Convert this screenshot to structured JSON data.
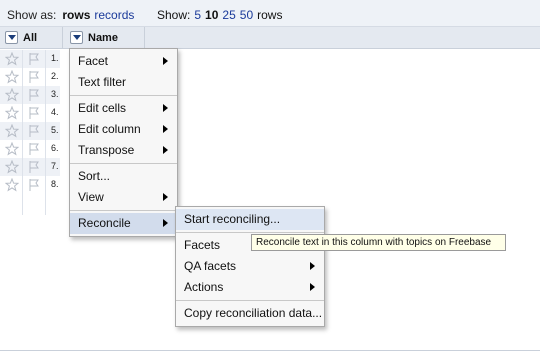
{
  "toolbar": {
    "show_as_label": "Show as:",
    "view_rows": "rows",
    "view_records": "records",
    "show_label": "Show:",
    "page_sizes": [
      "5",
      "10",
      "25",
      "50"
    ],
    "selected_page_size": "10",
    "rows_suffix": "rows"
  },
  "header": {
    "all_label": "All",
    "name_label": "Name"
  },
  "rows": [
    "1.",
    "2.",
    "3.",
    "4.",
    "5.",
    "6.",
    "7.",
    "8."
  ],
  "column_menu": {
    "items": [
      {
        "label": "Facet",
        "submenu": true
      },
      {
        "label": "Text filter",
        "submenu": false
      },
      {
        "label": "Edit cells",
        "submenu": true
      },
      {
        "label": "Edit column",
        "submenu": true
      },
      {
        "label": "Transpose",
        "submenu": true
      },
      {
        "label": "Sort...",
        "submenu": false
      },
      {
        "label": "View",
        "submenu": true
      },
      {
        "label": "Reconcile",
        "submenu": true
      }
    ]
  },
  "reconcile_menu": {
    "items": [
      {
        "label": "Start reconciling...",
        "submenu": false
      },
      {
        "label": "Facets",
        "submenu": false
      },
      {
        "label": "QA facets",
        "submenu": true
      },
      {
        "label": "Actions",
        "submenu": true
      },
      {
        "label": "Copy reconciliation data...",
        "submenu": false
      }
    ]
  },
  "tooltip": "Reconcile text in this column with topics on Freebase",
  "colors": {
    "link": "#1a3a9a",
    "menu_active": "#d2dcec",
    "tooltip_bg": "#ffffe8"
  }
}
